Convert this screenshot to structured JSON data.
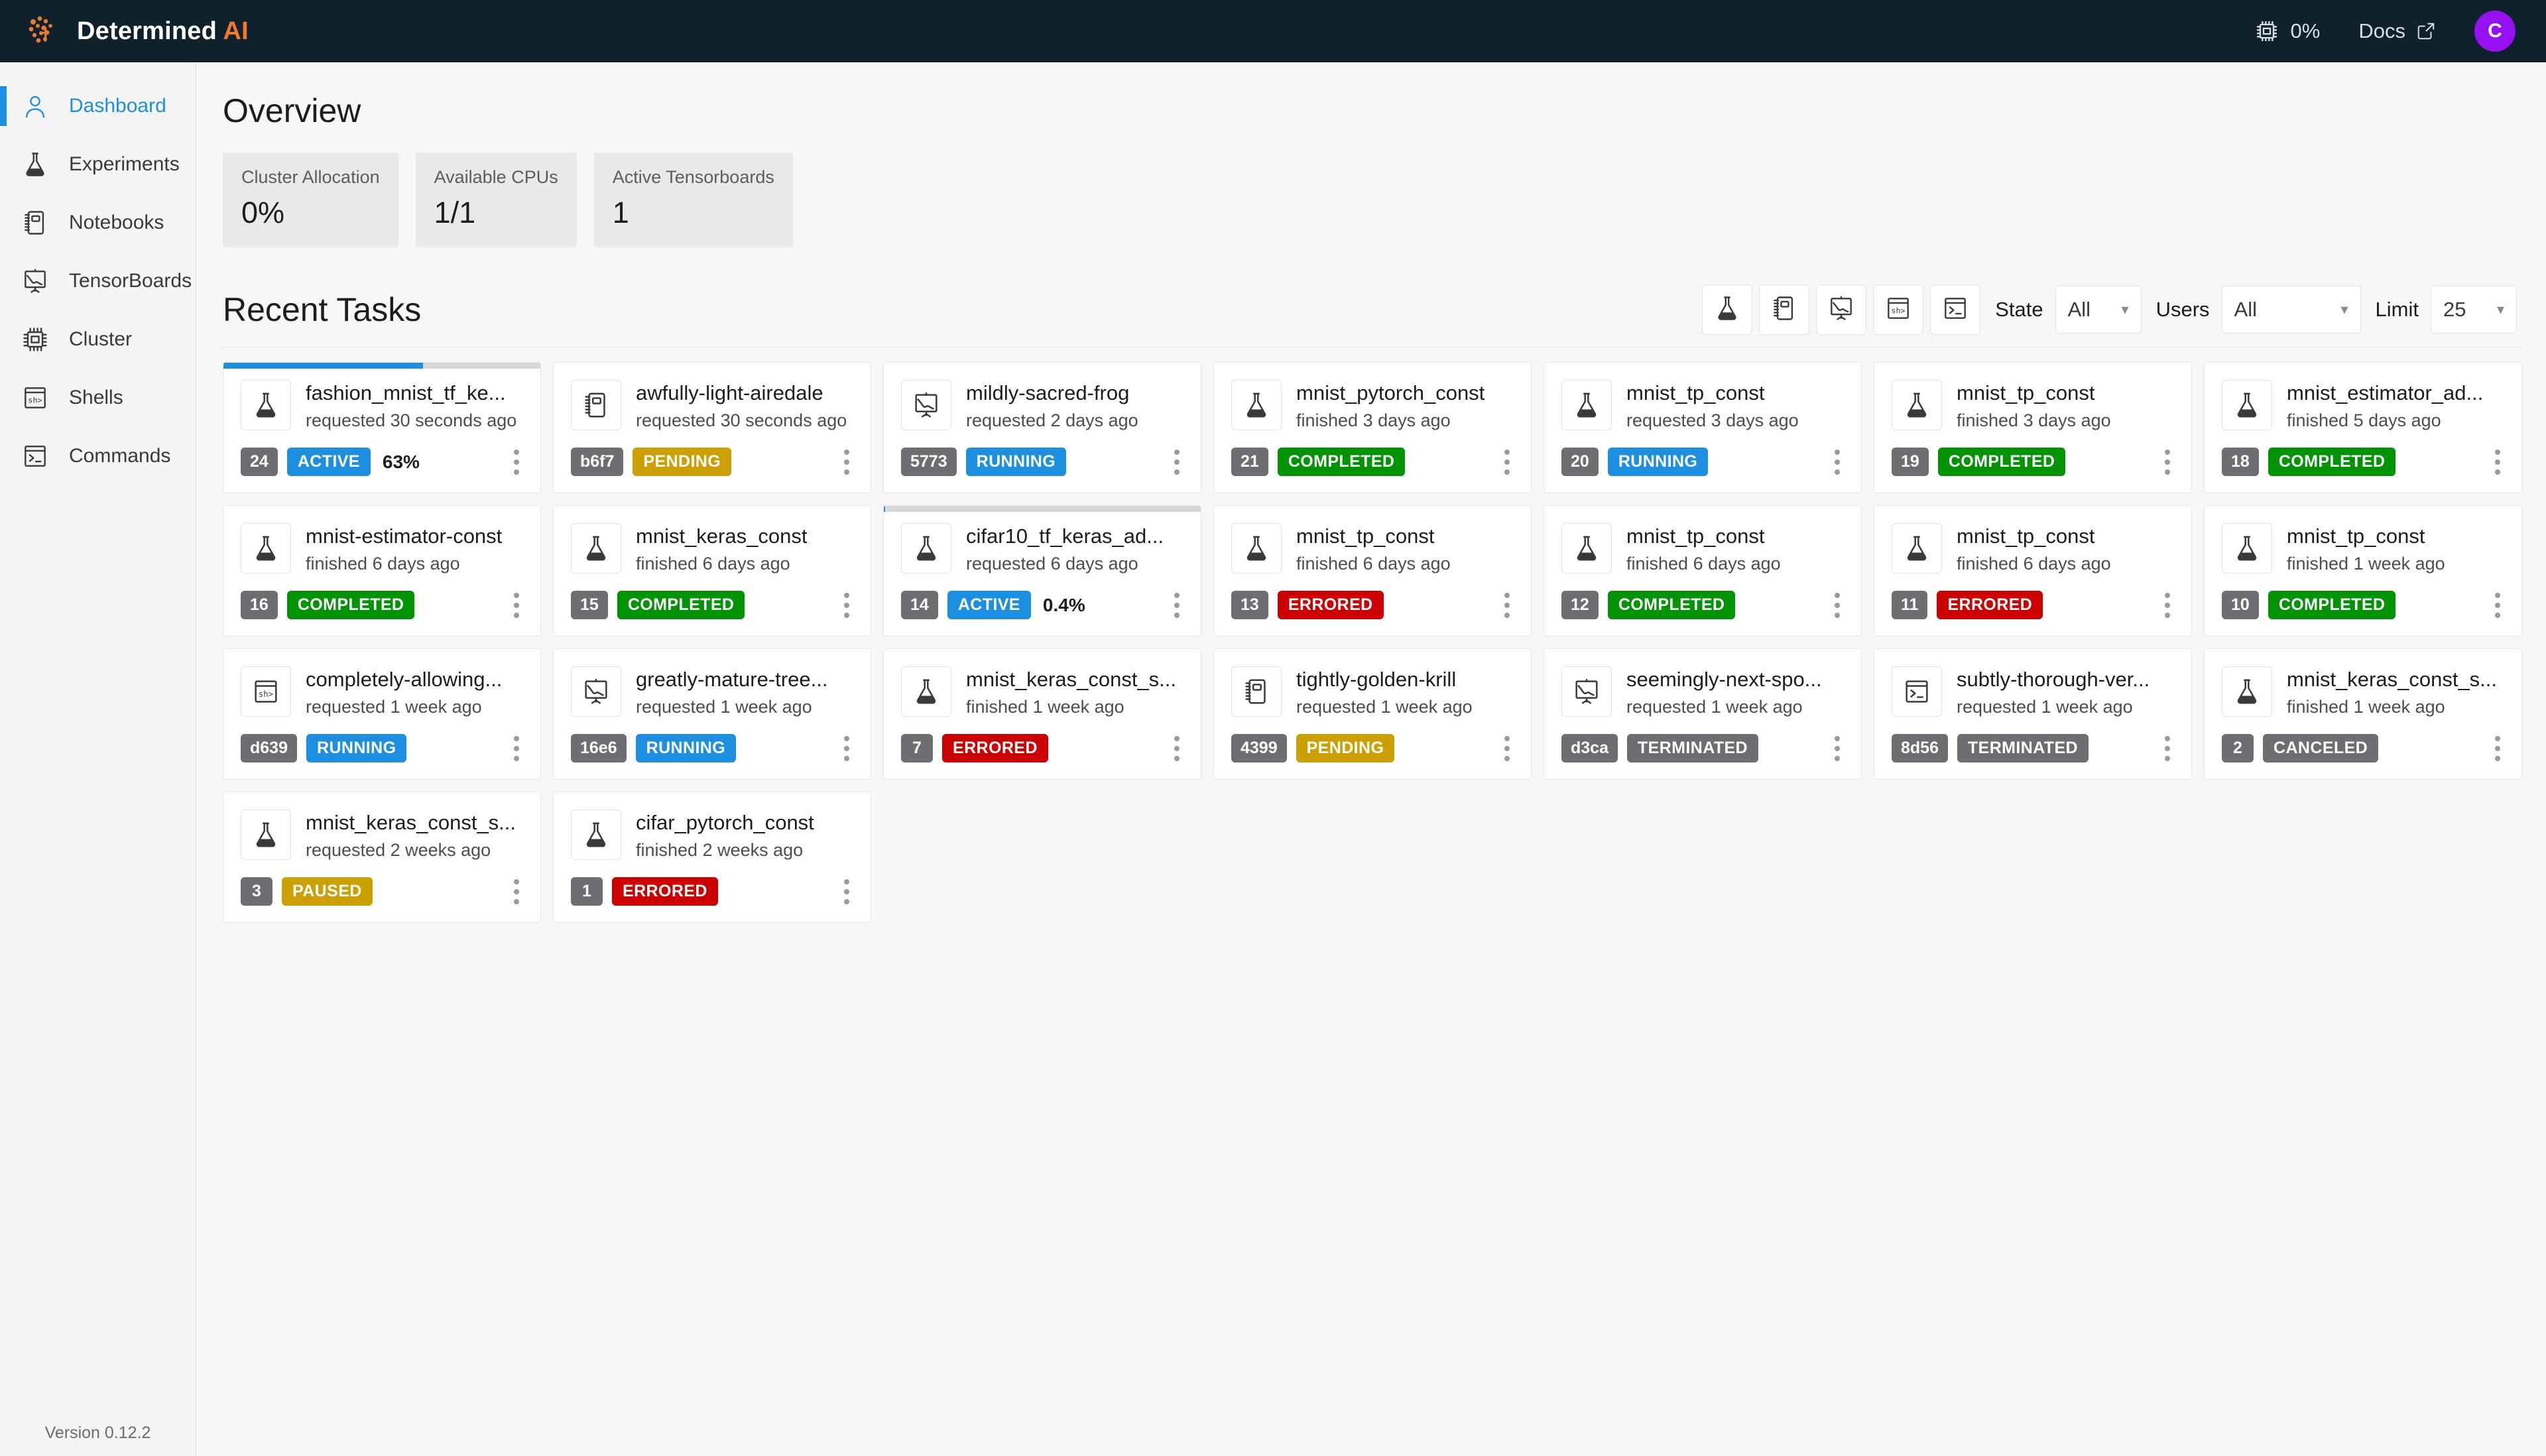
{
  "brand": {
    "name": "Determined",
    "suffix": "AI",
    "logo_icon": "brain-logo-icon"
  },
  "topbar": {
    "cluster_icon": "cpu-chip-icon",
    "cluster_percent": "0%",
    "docs_label": "Docs",
    "docs_external_icon": "external-link-icon",
    "avatar_initial": "C"
  },
  "sidebar": {
    "items": [
      {
        "label": "Dashboard",
        "icon": "user-icon",
        "active": true
      },
      {
        "label": "Experiments",
        "icon": "flask-icon",
        "active": false
      },
      {
        "label": "Notebooks",
        "icon": "notebook-icon",
        "active": false
      },
      {
        "label": "TensorBoards",
        "icon": "tensorboard-icon",
        "active": false
      },
      {
        "label": "Cluster",
        "icon": "cpu-chip-icon",
        "active": false
      },
      {
        "label": "Shells",
        "icon": "shell-icon",
        "active": false
      },
      {
        "label": "Commands",
        "icon": "terminal-icon",
        "active": false
      }
    ],
    "version": "Version 0.12.2"
  },
  "overview": {
    "title": "Overview",
    "stats": [
      {
        "label": "Cluster Allocation",
        "value": "0%"
      },
      {
        "label": "Available CPUs",
        "value": "1/1"
      },
      {
        "label": "Active Tensorboards",
        "value": "1"
      }
    ]
  },
  "tasks": {
    "title": "Recent Tasks",
    "type_filters": [
      {
        "icon": "flask-icon",
        "name": "experiments"
      },
      {
        "icon": "notebook-icon",
        "name": "notebooks"
      },
      {
        "icon": "tensorboard-icon",
        "name": "tensorboards"
      },
      {
        "icon": "shell-icon",
        "name": "shells"
      },
      {
        "icon": "terminal-icon",
        "name": "commands"
      }
    ],
    "filters": [
      {
        "label": "State",
        "value": "All",
        "size": "sm"
      },
      {
        "label": "Users",
        "value": "All",
        "size": "lg"
      },
      {
        "label": "Limit",
        "value": "25",
        "size": "sm"
      }
    ],
    "state_colors": {
      "ACTIVE": "#1d8fe0",
      "RUNNING": "#1d8fe0",
      "PENDING": "#ccа000",
      "COMPLETED": "#009405",
      "ERRORED": "#cc0000",
      "TERMINATED": "#6e6e72",
      "CANCELED": "#6e6e72",
      "PAUSED": "#cca000"
    },
    "cards": [
      {
        "name": "fashion_mnist_tf_ke...",
        "time": "requested 30 seconds ago",
        "id": "24",
        "state": "ACTIVE",
        "color": "#1d8fe0",
        "pct": "63%",
        "progress": 63,
        "icon": "flask-icon"
      },
      {
        "name": "awfully-light-airedale",
        "time": "requested 30 seconds ago",
        "id": "b6f7",
        "state": "PENDING",
        "color": "#cca000",
        "pct": "",
        "progress": null,
        "icon": "notebook-icon"
      },
      {
        "name": "mildly-sacred-frog",
        "time": "requested 2 days ago",
        "id": "5773",
        "state": "RUNNING",
        "color": "#1d8fe0",
        "pct": "",
        "progress": null,
        "icon": "tensorboard-icon"
      },
      {
        "name": "mnist_pytorch_const",
        "time": "finished 3 days ago",
        "id": "21",
        "state": "COMPLETED",
        "color": "#009405",
        "pct": "",
        "progress": null,
        "icon": "flask-icon"
      },
      {
        "name": "mnist_tp_const",
        "time": "requested 3 days ago",
        "id": "20",
        "state": "RUNNING",
        "color": "#1d8fe0",
        "pct": "",
        "progress": null,
        "icon": "flask-icon"
      },
      {
        "name": "mnist_tp_const",
        "time": "finished 3 days ago",
        "id": "19",
        "state": "COMPLETED",
        "color": "#009405",
        "pct": "",
        "progress": null,
        "icon": "flask-icon"
      },
      {
        "name": "mnist_estimator_ad...",
        "time": "finished 5 days ago",
        "id": "18",
        "state": "COMPLETED",
        "color": "#009405",
        "pct": "",
        "progress": null,
        "icon": "flask-icon"
      },
      {
        "name": "mnist-estimator-const",
        "time": "finished 6 days ago",
        "id": "16",
        "state": "COMPLETED",
        "color": "#009405",
        "pct": "",
        "progress": null,
        "icon": "flask-icon"
      },
      {
        "name": "mnist_keras_const",
        "time": "finished 6 days ago",
        "id": "15",
        "state": "COMPLETED",
        "color": "#009405",
        "pct": "",
        "progress": null,
        "icon": "flask-icon"
      },
      {
        "name": "cifar10_tf_keras_ad...",
        "time": "requested 6 days ago",
        "id": "14",
        "state": "ACTIVE",
        "color": "#1d8fe0",
        "pct": "0.4%",
        "progress": 0.4,
        "icon": "flask-icon"
      },
      {
        "name": "mnist_tp_const",
        "time": "finished 6 days ago",
        "id": "13",
        "state": "ERRORED",
        "color": "#cc0000",
        "pct": "",
        "progress": null,
        "icon": "flask-icon"
      },
      {
        "name": "mnist_tp_const",
        "time": "finished 6 days ago",
        "id": "12",
        "state": "COMPLETED",
        "color": "#009405",
        "pct": "",
        "progress": null,
        "icon": "flask-icon"
      },
      {
        "name": "mnist_tp_const",
        "time": "finished 6 days ago",
        "id": "11",
        "state": "ERRORED",
        "color": "#cc0000",
        "pct": "",
        "progress": null,
        "icon": "flask-icon"
      },
      {
        "name": "mnist_tp_const",
        "time": "finished 1 week ago",
        "id": "10",
        "state": "COMPLETED",
        "color": "#009405",
        "pct": "",
        "progress": null,
        "icon": "flask-icon"
      },
      {
        "name": "completely-allowing...",
        "time": "requested 1 week ago",
        "id": "d639",
        "state": "RUNNING",
        "color": "#1d8fe0",
        "pct": "",
        "progress": null,
        "icon": "shell-icon"
      },
      {
        "name": "greatly-mature-tree...",
        "time": "requested 1 week ago",
        "id": "16e6",
        "state": "RUNNING",
        "color": "#1d8fe0",
        "pct": "",
        "progress": null,
        "icon": "tensorboard-icon"
      },
      {
        "name": "mnist_keras_const_s...",
        "time": "finished 1 week ago",
        "id": "7",
        "state": "ERRORED",
        "color": "#cc0000",
        "pct": "",
        "progress": null,
        "icon": "flask-icon"
      },
      {
        "name": "tightly-golden-krill",
        "time": "requested 1 week ago",
        "id": "4399",
        "state": "PENDING",
        "color": "#cca000",
        "pct": "",
        "progress": null,
        "icon": "notebook-icon"
      },
      {
        "name": "seemingly-next-spo...",
        "time": "requested 1 week ago",
        "id": "d3ca",
        "state": "TERMINATED",
        "color": "#6e6e72",
        "pct": "",
        "progress": null,
        "icon": "tensorboard-icon"
      },
      {
        "name": "subtly-thorough-ver...",
        "time": "requested 1 week ago",
        "id": "8d56",
        "state": "TERMINATED",
        "color": "#6e6e72",
        "pct": "",
        "progress": null,
        "icon": "terminal-icon"
      },
      {
        "name": "mnist_keras_const_s...",
        "time": "finished 1 week ago",
        "id": "2",
        "state": "CANCELED",
        "color": "#6e6e72",
        "pct": "",
        "progress": null,
        "icon": "flask-icon"
      },
      {
        "name": "mnist_keras_const_s...",
        "time": "requested 2 weeks ago",
        "id": "3",
        "state": "PAUSED",
        "color": "#cca000",
        "pct": "",
        "progress": null,
        "icon": "flask-icon"
      },
      {
        "name": "cifar_pytorch_const",
        "time": "finished 2 weeks ago",
        "id": "1",
        "state": "ERRORED",
        "color": "#cc0000",
        "pct": "",
        "progress": null,
        "icon": "flask-icon"
      }
    ]
  }
}
